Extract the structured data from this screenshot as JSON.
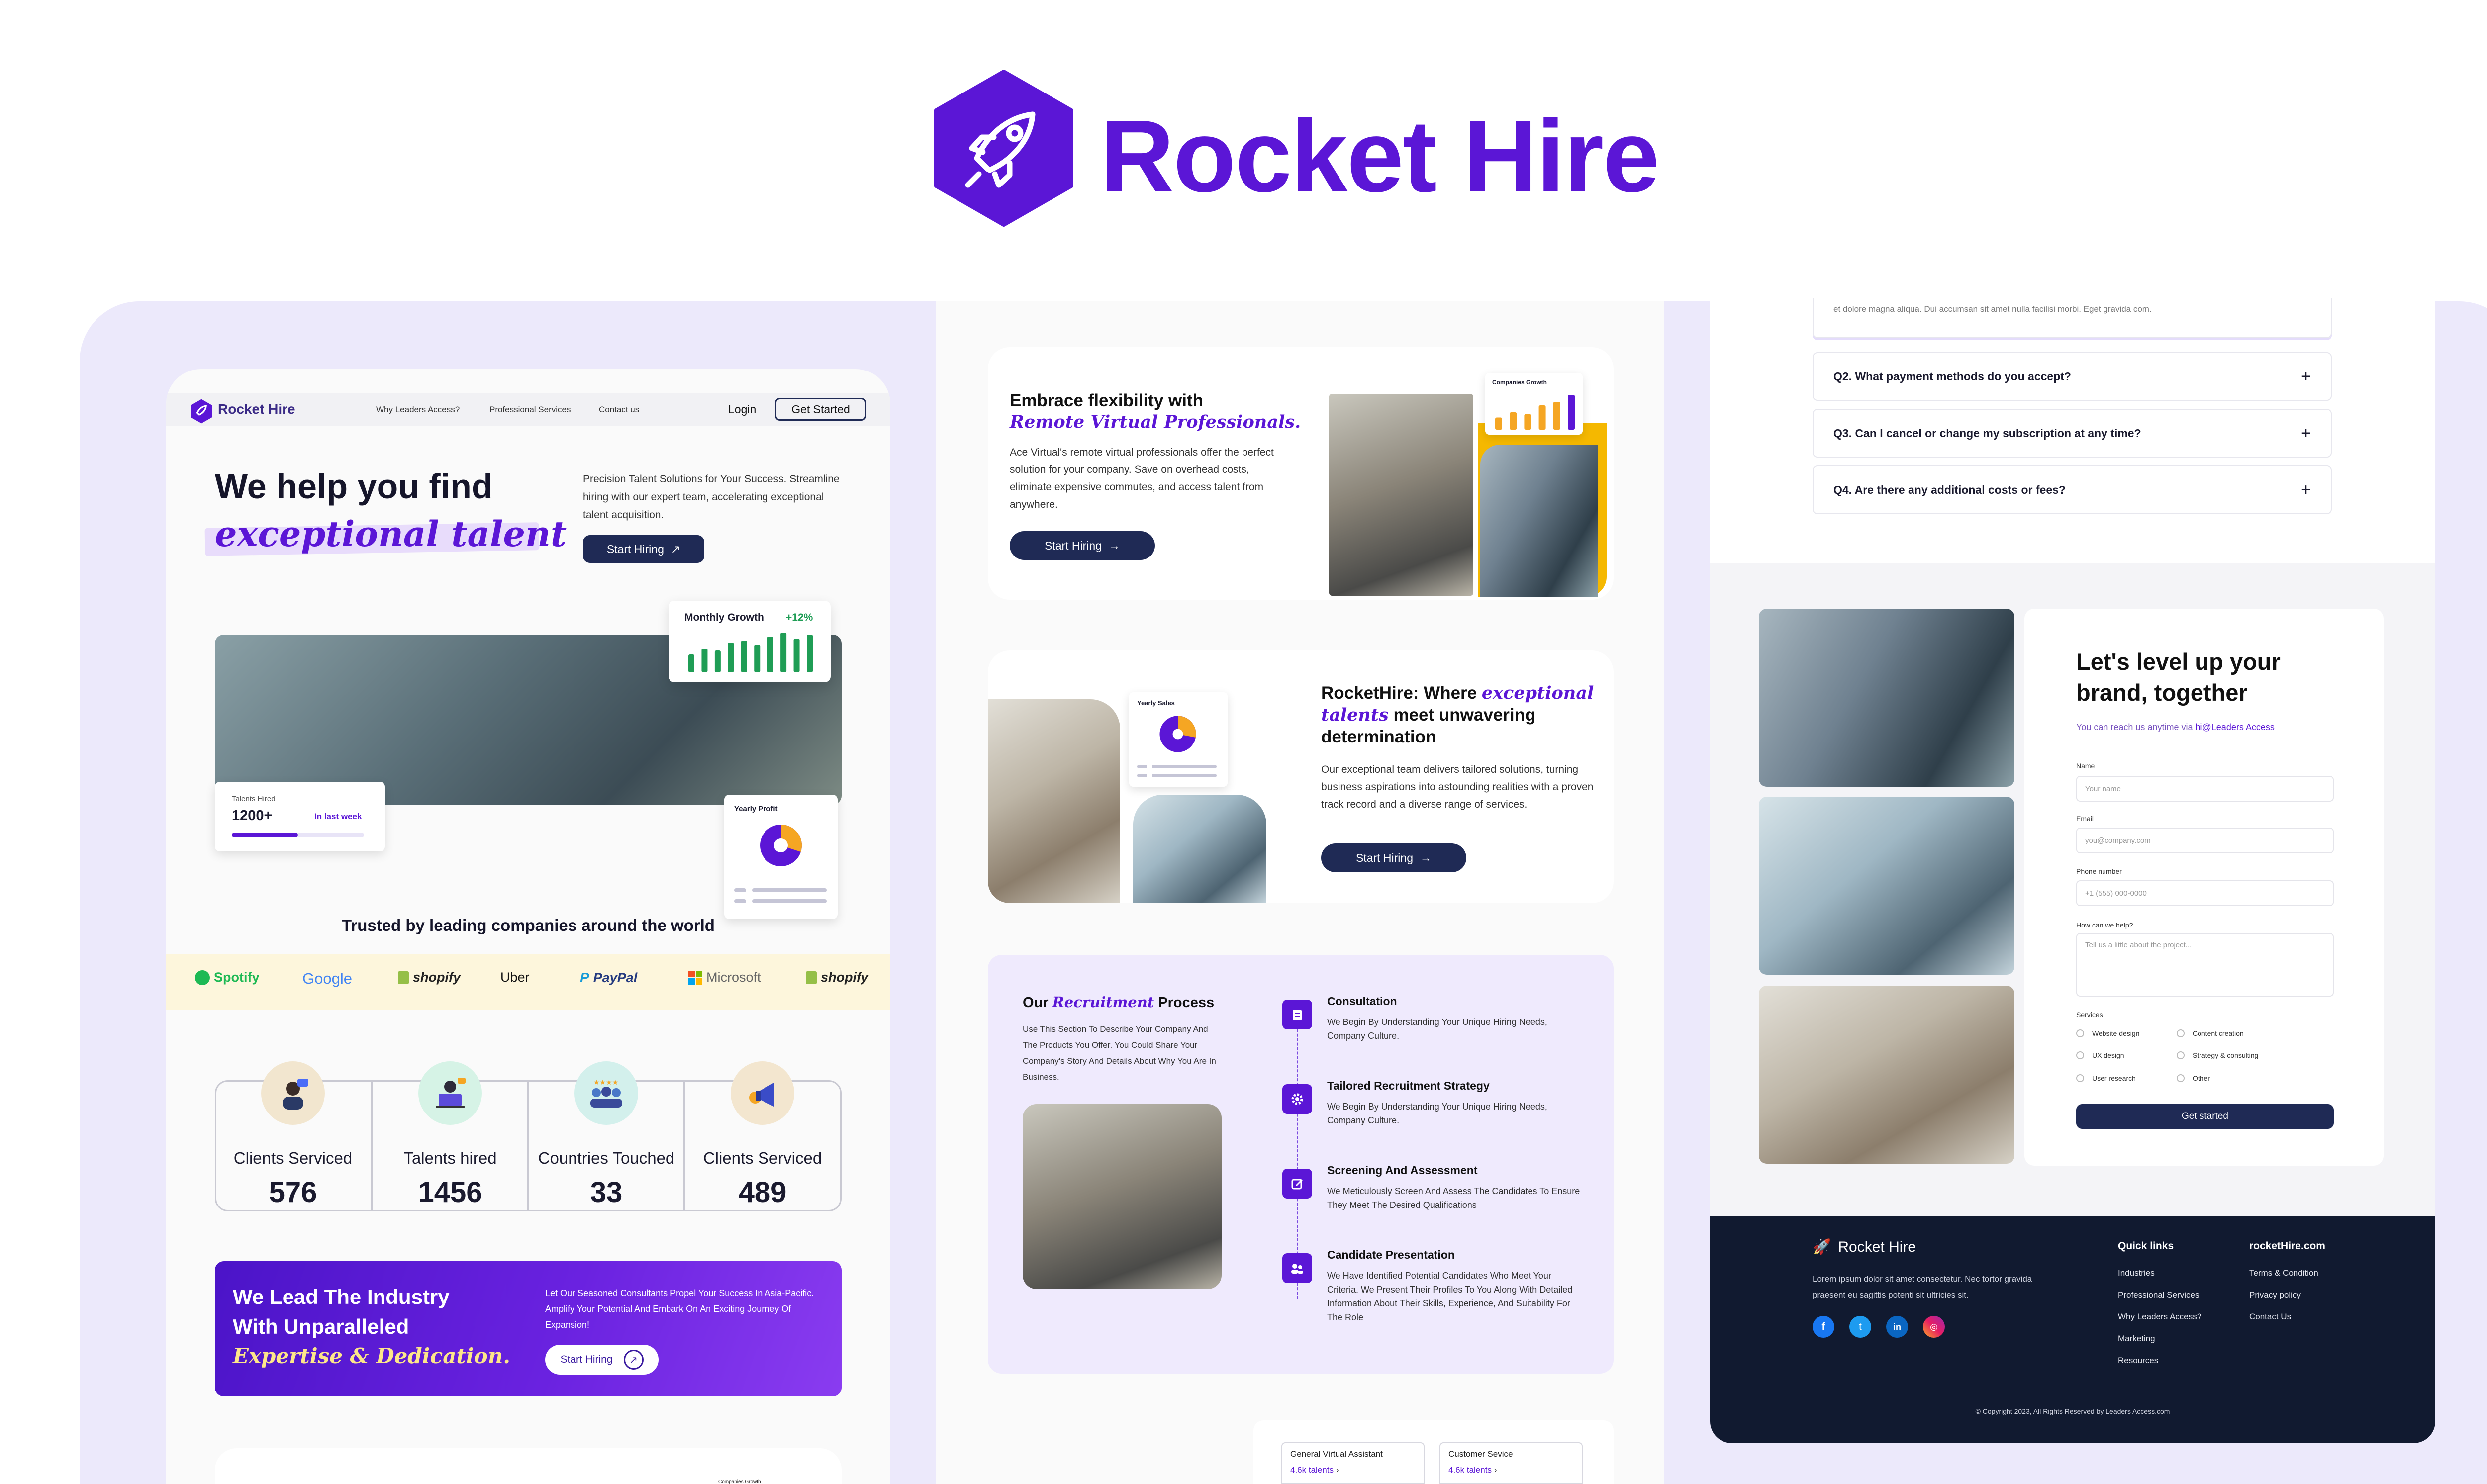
{
  "brand": {
    "name": "Rocket Hire",
    "accent": "#5b16d6",
    "panel_bg": "#ece9fb",
    "dark": "#1f2a55"
  },
  "home": {
    "nav": {
      "logo": "Rocket Hire",
      "links": [
        "Why Leaders Access?",
        "Professional Services",
        "Contact us"
      ],
      "login": "Login",
      "cta": "Get Started"
    },
    "hero": {
      "title_line1": "We help you find",
      "title_line2": "exceptional talent",
      "desc": "Precision Talent Solutions for Your Success. Streamline hiring with our expert team, accelerating exceptional talent acquisition.",
      "cta": "Start Hiring",
      "growth_card": {
        "title": "Monthly Growth",
        "change": "+12%",
        "bars": [
          0.45,
          0.6,
          0.55,
          0.75,
          0.8,
          0.7,
          0.9,
          1.0,
          0.85,
          0.95
        ]
      },
      "talents_card": {
        "label": "Talents Hired",
        "value": "1200+",
        "period": "In last week",
        "progress": 0.5
      },
      "profit_card": {
        "title": "Yearly Profit",
        "share": 0.3
      }
    },
    "trusted": "Trusted by leading companies around the world",
    "logos": [
      "Spotify",
      "Google",
      "shopify",
      "Uber",
      "PayPal",
      "Microsoft",
      "shopify"
    ],
    "stats": [
      {
        "label": "Clients Serviced",
        "value": "576",
        "icon": "support-agent-icon"
      },
      {
        "label": "Talents hired",
        "value": "1456",
        "icon": "laptop-user-icon"
      },
      {
        "label": "Countries Touched",
        "value": "33",
        "icon": "group-icon"
      },
      {
        "label": "Clients Serviced",
        "value": "489",
        "icon": "megaphone-icon"
      }
    ],
    "banner": {
      "line1": "We Lead The Industry",
      "line2": "With Unparalleled",
      "line3": "Expertise & Dedication.",
      "desc": "Let Our Seasoned Consultants Propel Your Success In Asia-Pacific. Amplify Your Potential And Embark On An Exciting Journey Of Expansion!",
      "cta": "Start Hiring"
    },
    "next_card": {
      "label": "Companies Growth"
    }
  },
  "middle": {
    "embrace": {
      "title": "Embrace flexibility with",
      "title_em": "Remote Virtual Professionals.",
      "desc": "Ace Virtual's remote virtual professionals offer the perfect solution for your company. Save on overhead costs, eliminate expensive commutes, and access talent from anywhere.",
      "cta": "Start Hiring",
      "chart_label": "Companies Growth",
      "chart_bars": [
        0.35,
        0.5,
        0.45,
        0.7,
        0.8,
        1.0
      ]
    },
    "rockethire": {
      "title_a": "RocketHire: Where",
      "title_em": "exceptional talents",
      "title_b": "meet unwavering determination",
      "desc": "Our exceptional team delivers tailored solutions, turning business aspirations into astounding realities with a proven track record and a diverse range of services.",
      "cta": "Start Hiring",
      "sales_label": "Yearly Sales",
      "sales_share": 0.28
    },
    "process": {
      "title_a": "Our",
      "title_em": "Recruitment",
      "title_b": "Process",
      "desc": "Use This Section To Describe Your Company And The Products You Offer. You Could Share Your Company's Story And Details About Why You Are In Business.",
      "steps": [
        {
          "title": "Consultation",
          "desc": "We Begin By Understanding Your Unique Hiring Needs, Company Culture.",
          "icon": "clipboard-icon"
        },
        {
          "title": "Tailored Recruitment Strategy",
          "desc": "We Begin By Understanding Your Unique Hiring Needs, Company Culture.",
          "icon": "gear-icon"
        },
        {
          "title": "Screening And Assessment",
          "desc": "We Meticulously Screen And Assess The Candidates To Ensure They Meet The Desired Qualifications",
          "icon": "edit-icon"
        },
        {
          "title": "Candidate Presentation",
          "desc": "We Have Identified Potential Candidates Who Meet Your Criteria. We Present Their Profiles To You Along With Detailed Information About Their Skills, Experience, And Suitability For The Role",
          "icon": "people-icon"
        }
      ]
    },
    "talent_cards": [
      {
        "title": "General Virtual Assistant",
        "count": "4.6k talents"
      },
      {
        "title": "Customer Sevice",
        "count": "4.6k talents"
      }
    ]
  },
  "right": {
    "faq_snippet": "et dolore magna aliqua. Dui accumsan sit amet nulla facilisi morbi. Eget gravida com.",
    "faqs": [
      "Q2. What payment methods do you accept?",
      "Q3. Can I cancel or change my subscription at any time?",
      "Q4. Are there any additional costs or fees?"
    ],
    "contact": {
      "title": "Let's level up your brand, together",
      "sub_a": "You can reach us anytime via",
      "sub_link": "hi@Leaders Access",
      "fields": [
        {
          "label": "Name",
          "placeholder": "Your name"
        },
        {
          "label": "Email",
          "placeholder": "you@company.com"
        },
        {
          "label": "Phone number",
          "placeholder": "+1 (555) 000-0000"
        },
        {
          "label": "How can we help?",
          "placeholder": "Tell us a little about the project..."
        }
      ],
      "services_label": "Services",
      "services": [
        "Website design",
        "Content creation",
        "UX design",
        "Strategy & consulting",
        "User research",
        "Other"
      ],
      "submit": "Get started"
    },
    "footer": {
      "logo": "Rocket Hire",
      "desc": "Lorem ipsum dolor sit amet consectetur. Nec tortor gravida praesent eu sagittis potenti sit ultricies sit.",
      "quick_title": "Quick links",
      "quick_links": [
        "Industries",
        "Professional Services",
        "Why Leaders Access?",
        "Marketing",
        "Resources"
      ],
      "site_title": "rocketHire.com",
      "site_links": [
        "Terms & Condition",
        "Privacy policy",
        "Contact Us"
      ],
      "copyright": "© Copyright 2023, All Rights Reserved by Leaders Access.com",
      "socials": [
        "facebook-icon",
        "twitter-icon",
        "linkedin-icon",
        "instagram-icon"
      ]
    }
  }
}
